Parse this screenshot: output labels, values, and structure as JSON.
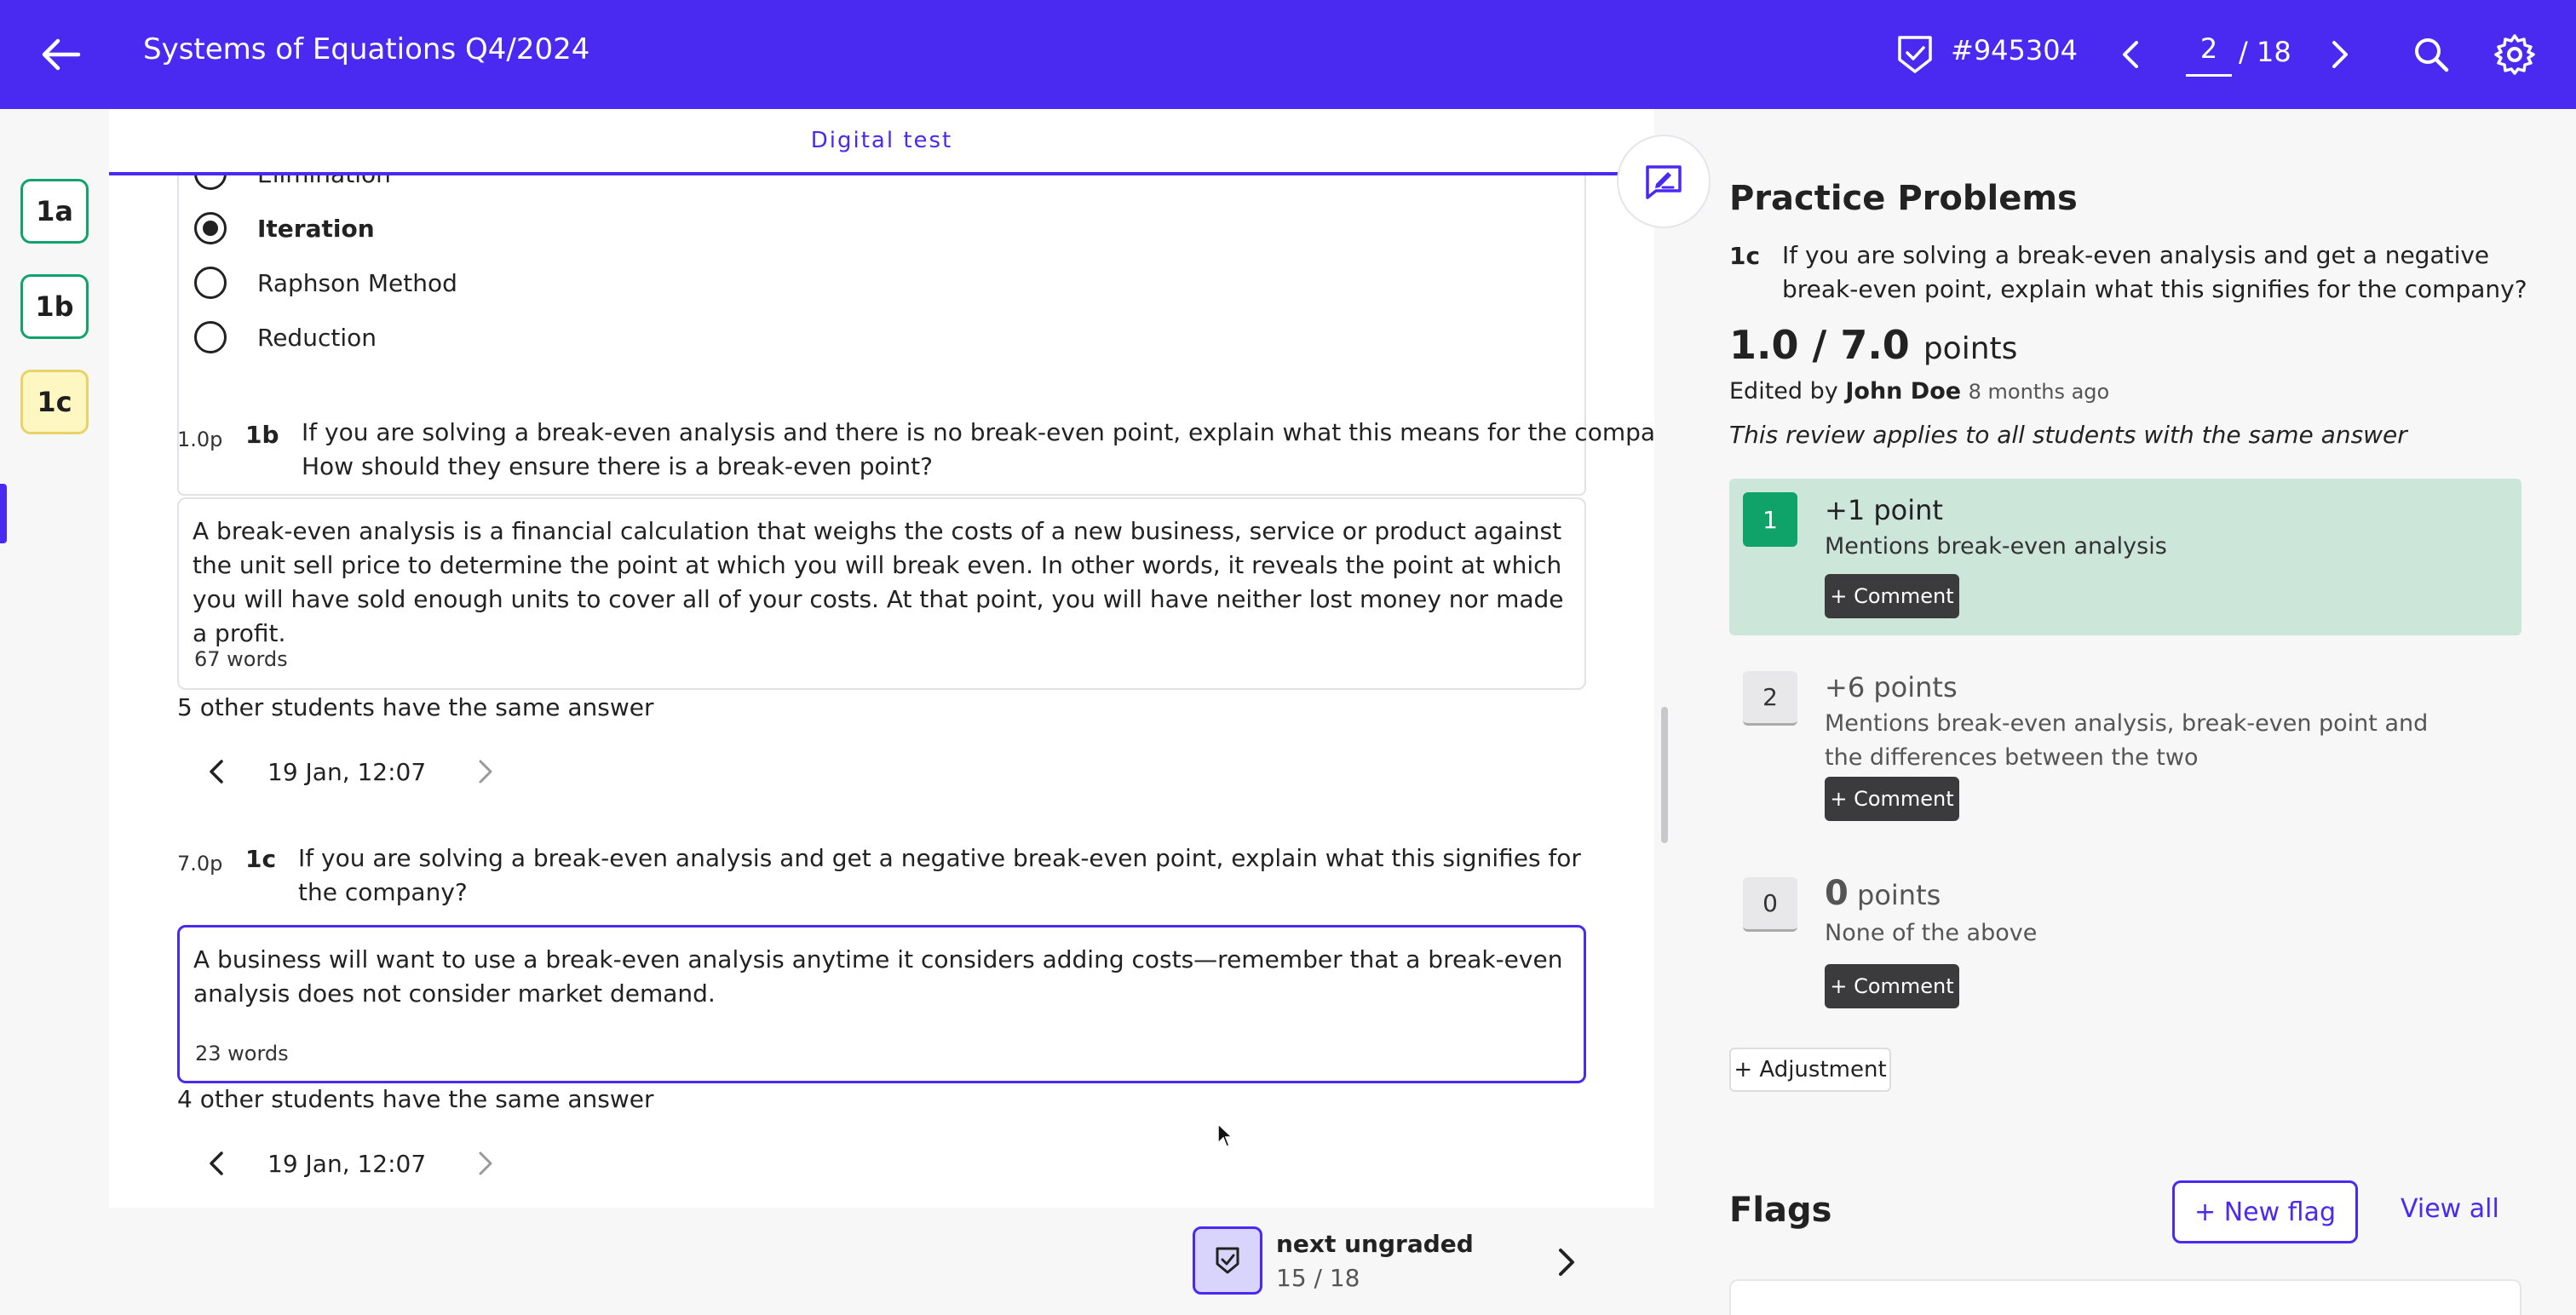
{
  "header": {
    "title": "Systems of Equations Q4/2024",
    "test_id": "#945304",
    "page_current": "2",
    "page_total": "/ 18"
  },
  "rail": {
    "items": [
      {
        "label": "1a"
      },
      {
        "label": "1b"
      },
      {
        "label": "1c"
      }
    ]
  },
  "middle": {
    "tab_label": "Digital test",
    "options": [
      {
        "label": "Elimination"
      },
      {
        "label": "Iteration"
      },
      {
        "label": "Raphson Method"
      },
      {
        "label": "Reduction"
      }
    ],
    "questions": [
      {
        "points": "1.0p",
        "id": "1b",
        "text": "If you are solving a break-even analysis and there is no break-even point, explain what this means for the company. How should they ensure there is a break-even point?",
        "answer": "A break-even analysis is a financial calculation that weighs the costs of a new business, service or product against the unit sell price to determine the point at which you will break even. In other words, it reveals the point at which you will have sold enough units to cover all of your costs. At that point, you will have neither lost money nor made a profit.",
        "words": "67 words",
        "same_answer": "5 other students have the same answer",
        "date": "19 Jan, 12:07"
      },
      {
        "points": "7.0p",
        "id": "1c",
        "text": "If you are solving a break-even analysis and get a negative break-even point, explain what this signifies for the company?",
        "answer": "A business will want to use a break-even analysis anytime it considers adding costs—remember that a break-even analysis does not consider market demand.",
        "words": "23 words",
        "same_answer": "4 other students have the same answer",
        "date": "19 Jan, 12:07"
      }
    ]
  },
  "right": {
    "title": "Practice Problems",
    "question_id": "1c",
    "question_text": "If you are solving a break-even analysis and get a negative break-even point, explain what this signifies for the company?",
    "score": "1.0 / 7.0",
    "score_unit": "points",
    "edited_prefix": "Edited by",
    "editor": "John Doe",
    "edited_ago": "8 months ago",
    "applies_note": "This review applies to all students with the same answer",
    "rubric": [
      {
        "num": "1",
        "points": "+1 point",
        "desc": "Mentions break-even analysis",
        "comment": "+ Comment"
      },
      {
        "num": "2",
        "points": "+6 points",
        "desc": "Mentions break-even analysis, break-even point and the differences between the two",
        "comment": "+ Comment"
      },
      {
        "num": "0",
        "points_big": "0",
        "points_unit": "points",
        "desc": "None of the above",
        "comment": "+ Comment"
      }
    ],
    "adjustment": "+ Adjustment",
    "flags_title": "Flags",
    "new_flag": "+ New flag",
    "view_all": "View all"
  },
  "footer": {
    "next_label": "next ungraded",
    "next_count": "15 / 18"
  },
  "colors": {
    "brand": "#4a2af0",
    "rubric_selected": "#cce6da",
    "rubric_green": "#0fa36a"
  }
}
